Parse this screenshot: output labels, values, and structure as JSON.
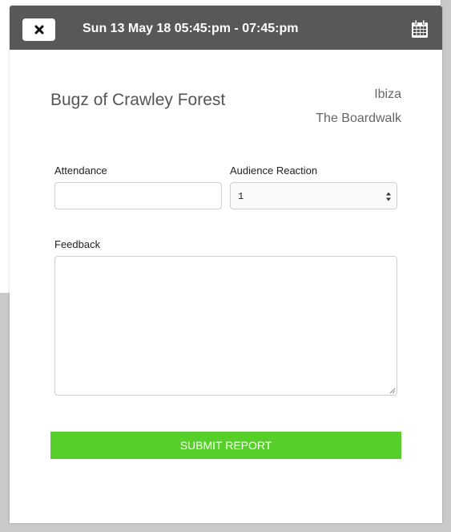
{
  "header": {
    "title": "Sun 13 May 18 05:45:pm - 07:45:pm",
    "close_icon": "close-icon",
    "calendar_icon": "calendar-icon",
    "background": "#58585a"
  },
  "event": {
    "name": "Bugz of Crawley Forest",
    "city": "Ibiza",
    "venue": "The Boardwalk"
  },
  "form": {
    "attendance": {
      "label": "Attendance",
      "value": "",
      "placeholder": ""
    },
    "audience_reaction": {
      "label": "Audience Reaction",
      "selected": "1"
    },
    "feedback": {
      "label": "Feedback",
      "value": ""
    },
    "submit_label": "SUBMIT REPORT",
    "submit_color": "#56cf2b"
  }
}
